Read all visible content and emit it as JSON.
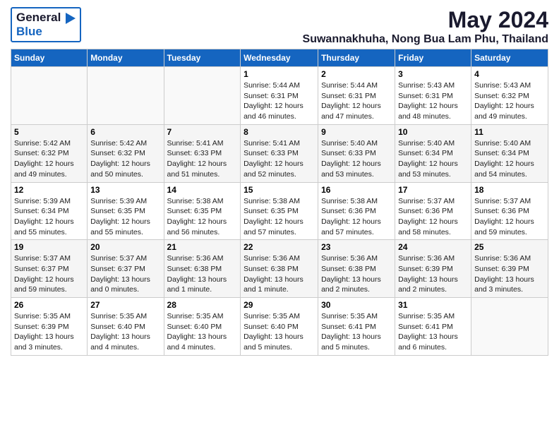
{
  "header": {
    "logo_general": "General",
    "logo_blue": "Blue",
    "main_title": "May 2024",
    "subtitle": "Suwannakhuha, Nong Bua Lam Phu, Thailand"
  },
  "calendar": {
    "days_of_week": [
      "Sunday",
      "Monday",
      "Tuesday",
      "Wednesday",
      "Thursday",
      "Friday",
      "Saturday"
    ],
    "weeks": [
      {
        "days": [
          {
            "number": "",
            "info": ""
          },
          {
            "number": "",
            "info": ""
          },
          {
            "number": "",
            "info": ""
          },
          {
            "number": "1",
            "info": "Sunrise: 5:44 AM\nSunset: 6:31 PM\nDaylight: 12 hours\nand 46 minutes."
          },
          {
            "number": "2",
            "info": "Sunrise: 5:44 AM\nSunset: 6:31 PM\nDaylight: 12 hours\nand 47 minutes."
          },
          {
            "number": "3",
            "info": "Sunrise: 5:43 AM\nSunset: 6:31 PM\nDaylight: 12 hours\nand 48 minutes."
          },
          {
            "number": "4",
            "info": "Sunrise: 5:43 AM\nSunset: 6:32 PM\nDaylight: 12 hours\nand 49 minutes."
          }
        ]
      },
      {
        "days": [
          {
            "number": "5",
            "info": "Sunrise: 5:42 AM\nSunset: 6:32 PM\nDaylight: 12 hours\nand 49 minutes."
          },
          {
            "number": "6",
            "info": "Sunrise: 5:42 AM\nSunset: 6:32 PM\nDaylight: 12 hours\nand 50 minutes."
          },
          {
            "number": "7",
            "info": "Sunrise: 5:41 AM\nSunset: 6:33 PM\nDaylight: 12 hours\nand 51 minutes."
          },
          {
            "number": "8",
            "info": "Sunrise: 5:41 AM\nSunset: 6:33 PM\nDaylight: 12 hours\nand 52 minutes."
          },
          {
            "number": "9",
            "info": "Sunrise: 5:40 AM\nSunset: 6:33 PM\nDaylight: 12 hours\nand 53 minutes."
          },
          {
            "number": "10",
            "info": "Sunrise: 5:40 AM\nSunset: 6:34 PM\nDaylight: 12 hours\nand 53 minutes."
          },
          {
            "number": "11",
            "info": "Sunrise: 5:40 AM\nSunset: 6:34 PM\nDaylight: 12 hours\nand 54 minutes."
          }
        ]
      },
      {
        "days": [
          {
            "number": "12",
            "info": "Sunrise: 5:39 AM\nSunset: 6:34 PM\nDaylight: 12 hours\nand 55 minutes."
          },
          {
            "number": "13",
            "info": "Sunrise: 5:39 AM\nSunset: 6:35 PM\nDaylight: 12 hours\nand 55 minutes."
          },
          {
            "number": "14",
            "info": "Sunrise: 5:38 AM\nSunset: 6:35 PM\nDaylight: 12 hours\nand 56 minutes."
          },
          {
            "number": "15",
            "info": "Sunrise: 5:38 AM\nSunset: 6:35 PM\nDaylight: 12 hours\nand 57 minutes."
          },
          {
            "number": "16",
            "info": "Sunrise: 5:38 AM\nSunset: 6:36 PM\nDaylight: 12 hours\nand 57 minutes."
          },
          {
            "number": "17",
            "info": "Sunrise: 5:37 AM\nSunset: 6:36 PM\nDaylight: 12 hours\nand 58 minutes."
          },
          {
            "number": "18",
            "info": "Sunrise: 5:37 AM\nSunset: 6:36 PM\nDaylight: 12 hours\nand 59 minutes."
          }
        ]
      },
      {
        "days": [
          {
            "number": "19",
            "info": "Sunrise: 5:37 AM\nSunset: 6:37 PM\nDaylight: 12 hours\nand 59 minutes."
          },
          {
            "number": "20",
            "info": "Sunrise: 5:37 AM\nSunset: 6:37 PM\nDaylight: 13 hours\nand 0 minutes."
          },
          {
            "number": "21",
            "info": "Sunrise: 5:36 AM\nSunset: 6:38 PM\nDaylight: 13 hours\nand 1 minute."
          },
          {
            "number": "22",
            "info": "Sunrise: 5:36 AM\nSunset: 6:38 PM\nDaylight: 13 hours\nand 1 minute."
          },
          {
            "number": "23",
            "info": "Sunrise: 5:36 AM\nSunset: 6:38 PM\nDaylight: 13 hours\nand 2 minutes."
          },
          {
            "number": "24",
            "info": "Sunrise: 5:36 AM\nSunset: 6:39 PM\nDaylight: 13 hours\nand 2 minutes."
          },
          {
            "number": "25",
            "info": "Sunrise: 5:36 AM\nSunset: 6:39 PM\nDaylight: 13 hours\nand 3 minutes."
          }
        ]
      },
      {
        "days": [
          {
            "number": "26",
            "info": "Sunrise: 5:35 AM\nSunset: 6:39 PM\nDaylight: 13 hours\nand 3 minutes."
          },
          {
            "number": "27",
            "info": "Sunrise: 5:35 AM\nSunset: 6:40 PM\nDaylight: 13 hours\nand 4 minutes."
          },
          {
            "number": "28",
            "info": "Sunrise: 5:35 AM\nSunset: 6:40 PM\nDaylight: 13 hours\nand 4 minutes."
          },
          {
            "number": "29",
            "info": "Sunrise: 5:35 AM\nSunset: 6:40 PM\nDaylight: 13 hours\nand 5 minutes."
          },
          {
            "number": "30",
            "info": "Sunrise: 5:35 AM\nSunset: 6:41 PM\nDaylight: 13 hours\nand 5 minutes."
          },
          {
            "number": "31",
            "info": "Sunrise: 5:35 AM\nSunset: 6:41 PM\nDaylight: 13 hours\nand 6 minutes."
          },
          {
            "number": "",
            "info": ""
          }
        ]
      }
    ]
  }
}
